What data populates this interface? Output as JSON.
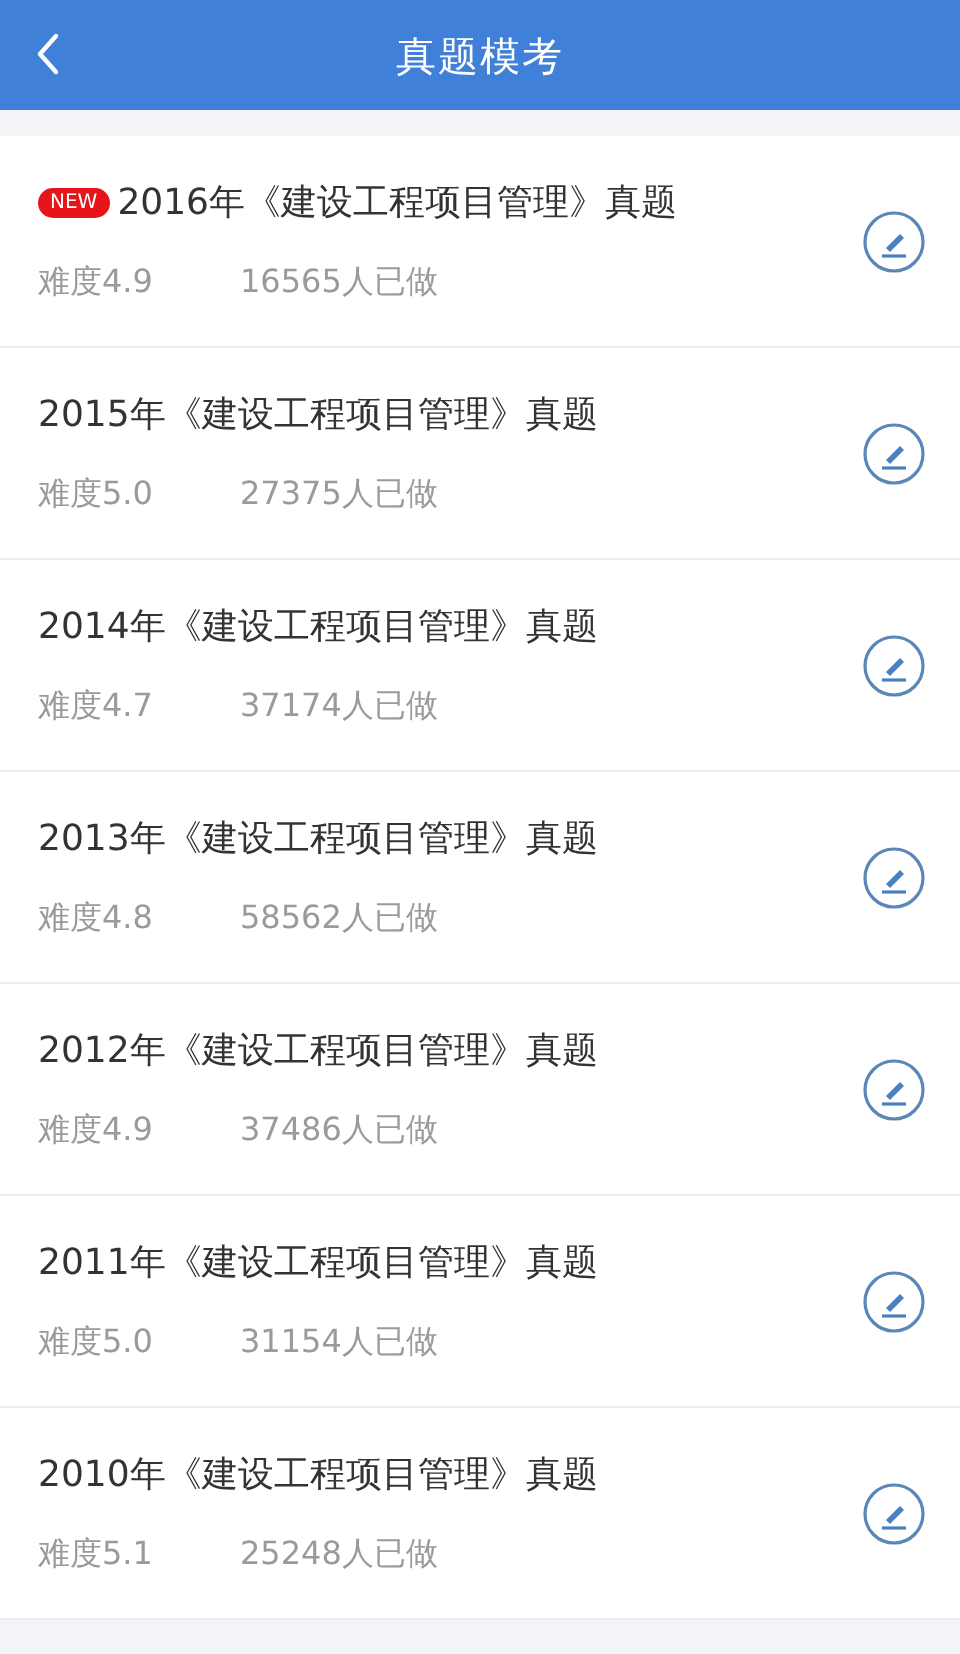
{
  "header": {
    "title": "真题模考"
  },
  "items": [
    {
      "badge": "NEW",
      "title": "2016年《建设工程项目管理》真题",
      "difficulty": "难度4.9",
      "count": "16565人已做"
    },
    {
      "title": "2015年《建设工程项目管理》真题",
      "difficulty": "难度5.0",
      "count": "27375人已做"
    },
    {
      "title": "2014年《建设工程项目管理》真题",
      "difficulty": "难度4.7",
      "count": "37174人已做"
    },
    {
      "title": "2013年《建设工程项目管理》真题",
      "difficulty": "难度4.8",
      "count": "58562人已做"
    },
    {
      "title": "2012年《建设工程项目管理》真题",
      "difficulty": "难度4.9",
      "count": "37486人已做"
    },
    {
      "title": "2011年《建设工程项目管理》真题",
      "difficulty": "难度5.0",
      "count": "31154人已做"
    },
    {
      "title": "2010年《建设工程项目管理》真题",
      "difficulty": "难度5.1",
      "count": "25248人已做"
    }
  ]
}
